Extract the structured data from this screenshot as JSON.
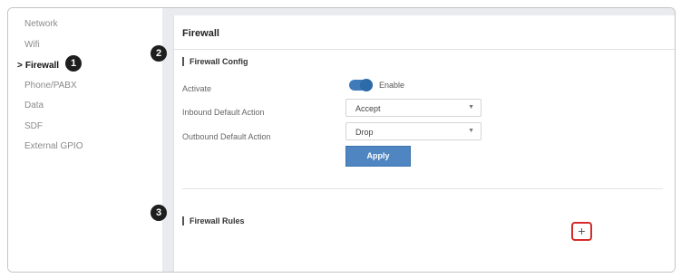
{
  "sidebar": {
    "items": [
      {
        "label": "Network"
      },
      {
        "label": "Wifi"
      },
      {
        "label": "Firewall",
        "active": true
      },
      {
        "label": "Phone/PABX"
      },
      {
        "label": "Data"
      },
      {
        "label": "SDF"
      },
      {
        "label": "External GPIO"
      }
    ],
    "active_indicator": ">"
  },
  "page": {
    "title": "Firewall"
  },
  "firewall_config": {
    "title": "Firewall Config",
    "activate_label": "Activate",
    "activate_toggle_label": "Enable",
    "activate_enabled": true,
    "inbound_label": "Inbound Default Action",
    "inbound_value": "Accept",
    "outbound_label": "Outbound Default Action",
    "outbound_value": "Drop",
    "apply_label": "Apply"
  },
  "firewall_rules": {
    "title": "Firewall Rules",
    "add_label": "+"
  },
  "markers": [
    "1",
    "2",
    "3"
  ],
  "colors": {
    "accent": "#4f86c2",
    "highlight": "#d62b2b",
    "content_background": "#e9ebee"
  }
}
